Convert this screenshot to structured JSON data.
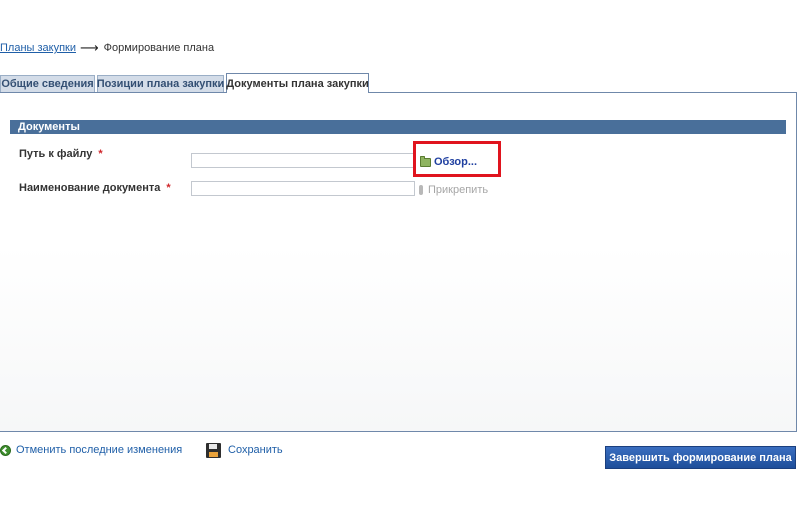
{
  "breadcrumb": {
    "parent_link": "Планы закупки",
    "arrow": "⟶",
    "current": "Формирование плана"
  },
  "tabs": [
    {
      "label": "Общие сведения",
      "active": false
    },
    {
      "label": "Позиции плана закупки",
      "active": false
    },
    {
      "label": "Документы плана закупки",
      "active": true
    }
  ],
  "documents_section": {
    "header": "Документы",
    "file_path": {
      "label": "Путь к файлу",
      "required_mark": "*",
      "value": "",
      "placeholder": "",
      "browse_label": "Обзор...",
      "browse_icon": "folder-icon"
    },
    "document_name": {
      "label": "Наименование документа",
      "required_mark": "*",
      "value": "",
      "placeholder": "",
      "attach_label": "Прикрепить",
      "attach_icon": "paperclip-icon"
    }
  },
  "footer": {
    "undo_label": "Отменить последние изменения",
    "undo_icon": "undo-icon",
    "save_label": "Сохранить",
    "save_icon": "floppy-disk-icon",
    "finish_label": "Завершить формирование плана"
  },
  "colors": {
    "section_header": "#496f9a",
    "tab_inactive": "#d3dce8",
    "panel_border": "#6f88aa",
    "link": "#1f5fa8",
    "required": "#d0262a",
    "highlight": "#e0141e",
    "primary_button": "#1e4e9a"
  }
}
